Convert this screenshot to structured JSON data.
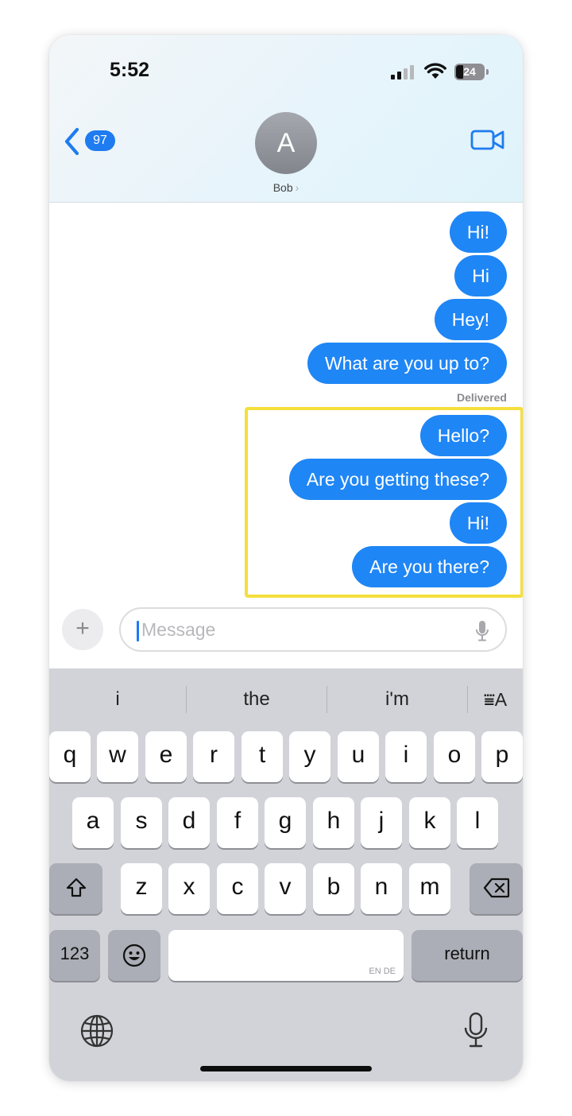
{
  "status_bar": {
    "time": "5:52",
    "battery": "24"
  },
  "header": {
    "back_badge": "97",
    "avatar_initial": "A",
    "contact_name": "Bob",
    "contact_chevron": "›"
  },
  "messages": {
    "items": [
      {
        "text": "Hi!"
      },
      {
        "text": "Hi"
      },
      {
        "text": "Hey!"
      },
      {
        "text": "What are you up to?"
      },
      {
        "text": "Hello?"
      },
      {
        "text": "Are you getting these?"
      },
      {
        "text": "Hi!"
      },
      {
        "text": "Are you there?"
      }
    ],
    "delivered_label": "Delivered"
  },
  "input_bar": {
    "plus_label": "+",
    "placeholder": "Message"
  },
  "keyboard": {
    "suggestions": [
      "i",
      "the",
      "i'm"
    ],
    "format_label": "⩸A",
    "row1": [
      "q",
      "w",
      "e",
      "r",
      "t",
      "y",
      "u",
      "i",
      "o",
      "p"
    ],
    "row2": [
      "a",
      "s",
      "d",
      "f",
      "g",
      "h",
      "j",
      "k",
      "l"
    ],
    "row3": [
      "z",
      "x",
      "c",
      "v",
      "b",
      "n",
      "m"
    ],
    "numbers_label": "123",
    "emoji_label": "☺",
    "space_language": "EN DE",
    "return_label": "return"
  },
  "colors": {
    "bubble": "#1f86f5",
    "accent": "#1e7cf0",
    "highlight": "#f5df3c",
    "keyboard_bg": "#d2d3d8"
  },
  "icons": [
    "back-chevron-icon",
    "video-camera-icon",
    "microphone-icon",
    "shift-icon",
    "delete-icon",
    "globe-icon",
    "emoji-icon"
  ]
}
